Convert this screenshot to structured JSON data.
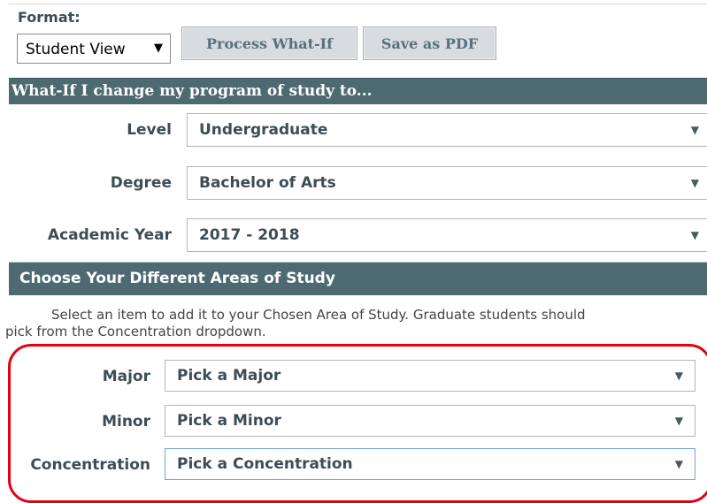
{
  "format": {
    "label": "Format:",
    "selected": "Student View",
    "caret": "▼"
  },
  "buttons": {
    "process": "Process What-If",
    "save_pdf": "Save as PDF"
  },
  "section_program": {
    "title": "What-If I change my program of study to...",
    "level": {
      "label": "Level",
      "value": "Undergraduate"
    },
    "degree": {
      "label": "Degree",
      "value": "Bachelor of Arts"
    },
    "academic_year": {
      "label": "Academic Year",
      "value": "2017 - 2018"
    }
  },
  "section_areas": {
    "title": "Choose Your Different Areas of Study",
    "help_line1": "Select an item to add it to your Chosen Area of Study. Graduate students should",
    "help_line2": "pick from the Concentration dropdown.",
    "major": {
      "label": "Major",
      "value": "Pick a Major"
    },
    "minor": {
      "label": "Minor",
      "value": "Pick a Minor"
    },
    "concentration": {
      "label": "Concentration",
      "value": "Pick a Concentration"
    }
  },
  "icons": {
    "dropdown_arrow": "▼"
  },
  "colors": {
    "section_bar": "#4e6a71",
    "highlight": "#e4000f",
    "label_text": "#3d4d55"
  }
}
